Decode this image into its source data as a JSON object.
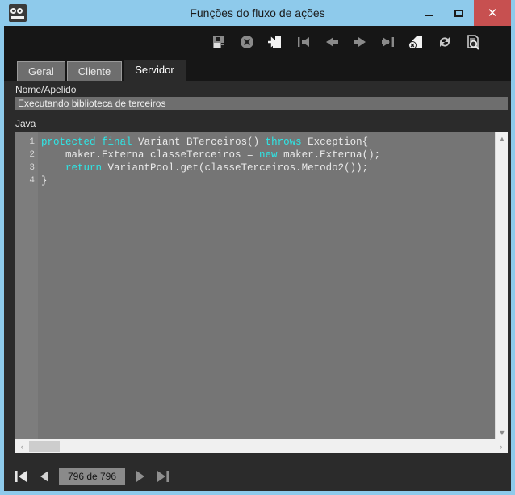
{
  "window": {
    "title": "Funções do fluxo de ações",
    "app_icon": "binoculars-icon",
    "controls": {
      "minimize": "–",
      "maximize": "□",
      "close": "✕"
    },
    "accent_color": "#8ecaeb",
    "close_color": "#c75050"
  },
  "toolbar": {
    "items": [
      {
        "name": "save-icon",
        "label": "Salvar"
      },
      {
        "name": "cancel-icon",
        "label": "Cancelar"
      },
      {
        "name": "new-record-icon",
        "label": "Novo"
      },
      {
        "name": "first-record-icon",
        "label": "Primeiro"
      },
      {
        "name": "previous-record-icon",
        "label": "Anterior"
      },
      {
        "name": "next-record-icon",
        "label": "Próximo"
      },
      {
        "name": "last-record-icon",
        "label": "Último"
      },
      {
        "name": "delete-record-icon",
        "label": "Excluir"
      },
      {
        "name": "refresh-icon",
        "label": "Atualizar"
      },
      {
        "name": "search-record-icon",
        "label": "Pesquisar"
      }
    ]
  },
  "tabs": [
    {
      "label": "Geral",
      "active": false
    },
    {
      "label": "Cliente",
      "active": false
    },
    {
      "label": "Servidor",
      "active": true
    }
  ],
  "form": {
    "name_label": "Nome/Apelido",
    "name_value": "Executando biblioteca de terceiros",
    "name_placeholder": "",
    "code_label": "Java"
  },
  "editor": {
    "line_numbers": [
      "1",
      "2",
      "3",
      "4"
    ],
    "lines": [
      {
        "number": "1",
        "tokens": [
          {
            "t": "protected",
            "c": "kw"
          },
          {
            "t": " ",
            "c": "pn"
          },
          {
            "t": "final",
            "c": "kw"
          },
          {
            "t": " Variant BTerceiros() ",
            "c": "id"
          },
          {
            "t": "throws",
            "c": "kw"
          },
          {
            "t": " Exception{",
            "c": "id"
          }
        ]
      },
      {
        "number": "2",
        "tokens": [
          {
            "t": "    maker.Externa classeTerceiros = ",
            "c": "id"
          },
          {
            "t": "new",
            "c": "kw"
          },
          {
            "t": " maker.Externa();",
            "c": "id"
          }
        ]
      },
      {
        "number": "3",
        "tokens": [
          {
            "t": "    ",
            "c": "id"
          },
          {
            "t": "return",
            "c": "kw"
          },
          {
            "t": " VariantPool.get(classeTerceiros.Metodo2());",
            "c": "id"
          }
        ]
      },
      {
        "number": "4",
        "tokens": [
          {
            "t": "}",
            "c": "id"
          }
        ]
      }
    ],
    "vscroll_up": "▲",
    "vscroll_down": "▼",
    "hscroll_left": "‹",
    "hscroll_right": "›"
  },
  "navbar": {
    "first_label": "Primeiro registro",
    "previous_label": "Registro anterior",
    "counter": "796 de 796",
    "next_label": "Próximo registro",
    "last_label": "Último registro"
  }
}
